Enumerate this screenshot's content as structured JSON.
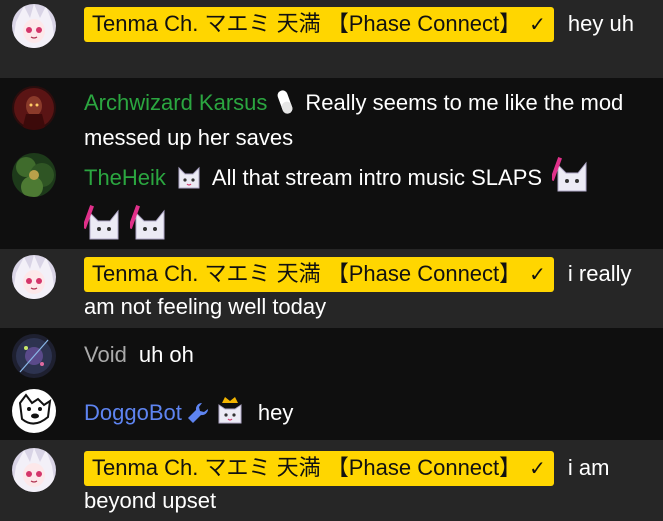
{
  "messages": [
    {
      "author": "Tenma Ch. マエミ 天満 【Phase Connect】",
      "text": "hey uh",
      "role": "owner"
    },
    {
      "author": "Archwizard Karsus",
      "text": "Really seems to me like the mod messed up her saves",
      "role": "member",
      "badge": "pill-badge-icon"
    },
    {
      "author": "TheHeik",
      "text": "All that stream intro music SLAPS",
      "role": "member",
      "badge": "cat-badge-icon",
      "emotes": [
        "tenma-slaps-emote",
        "tenma-slaps-emote",
        "tenma-slaps-emote"
      ]
    },
    {
      "author": "Tenma Ch. マエミ 天満 【Phase Connect】",
      "text": "i really am not feeling well today",
      "role": "owner"
    },
    {
      "author": "Void",
      "text": "uh oh",
      "role": "viewer"
    },
    {
      "author": "DoggoBot",
      "text": "hey",
      "role": "moderator",
      "badges": [
        "wrench-icon",
        "crown-cat-badge-icon"
      ]
    },
    {
      "author": "Tenma Ch. マエミ 天満 【Phase Connect】",
      "text": "i am beyond upset",
      "role": "owner"
    }
  ],
  "colors": {
    "background": "#0f0f0f",
    "owner_row": "#262626",
    "owner_badge": "#ffd600",
    "member_name": "#2ba640",
    "viewer_name": "#aaaaaa",
    "moderator_name": "#5e84f1",
    "text": "#ffffff"
  }
}
